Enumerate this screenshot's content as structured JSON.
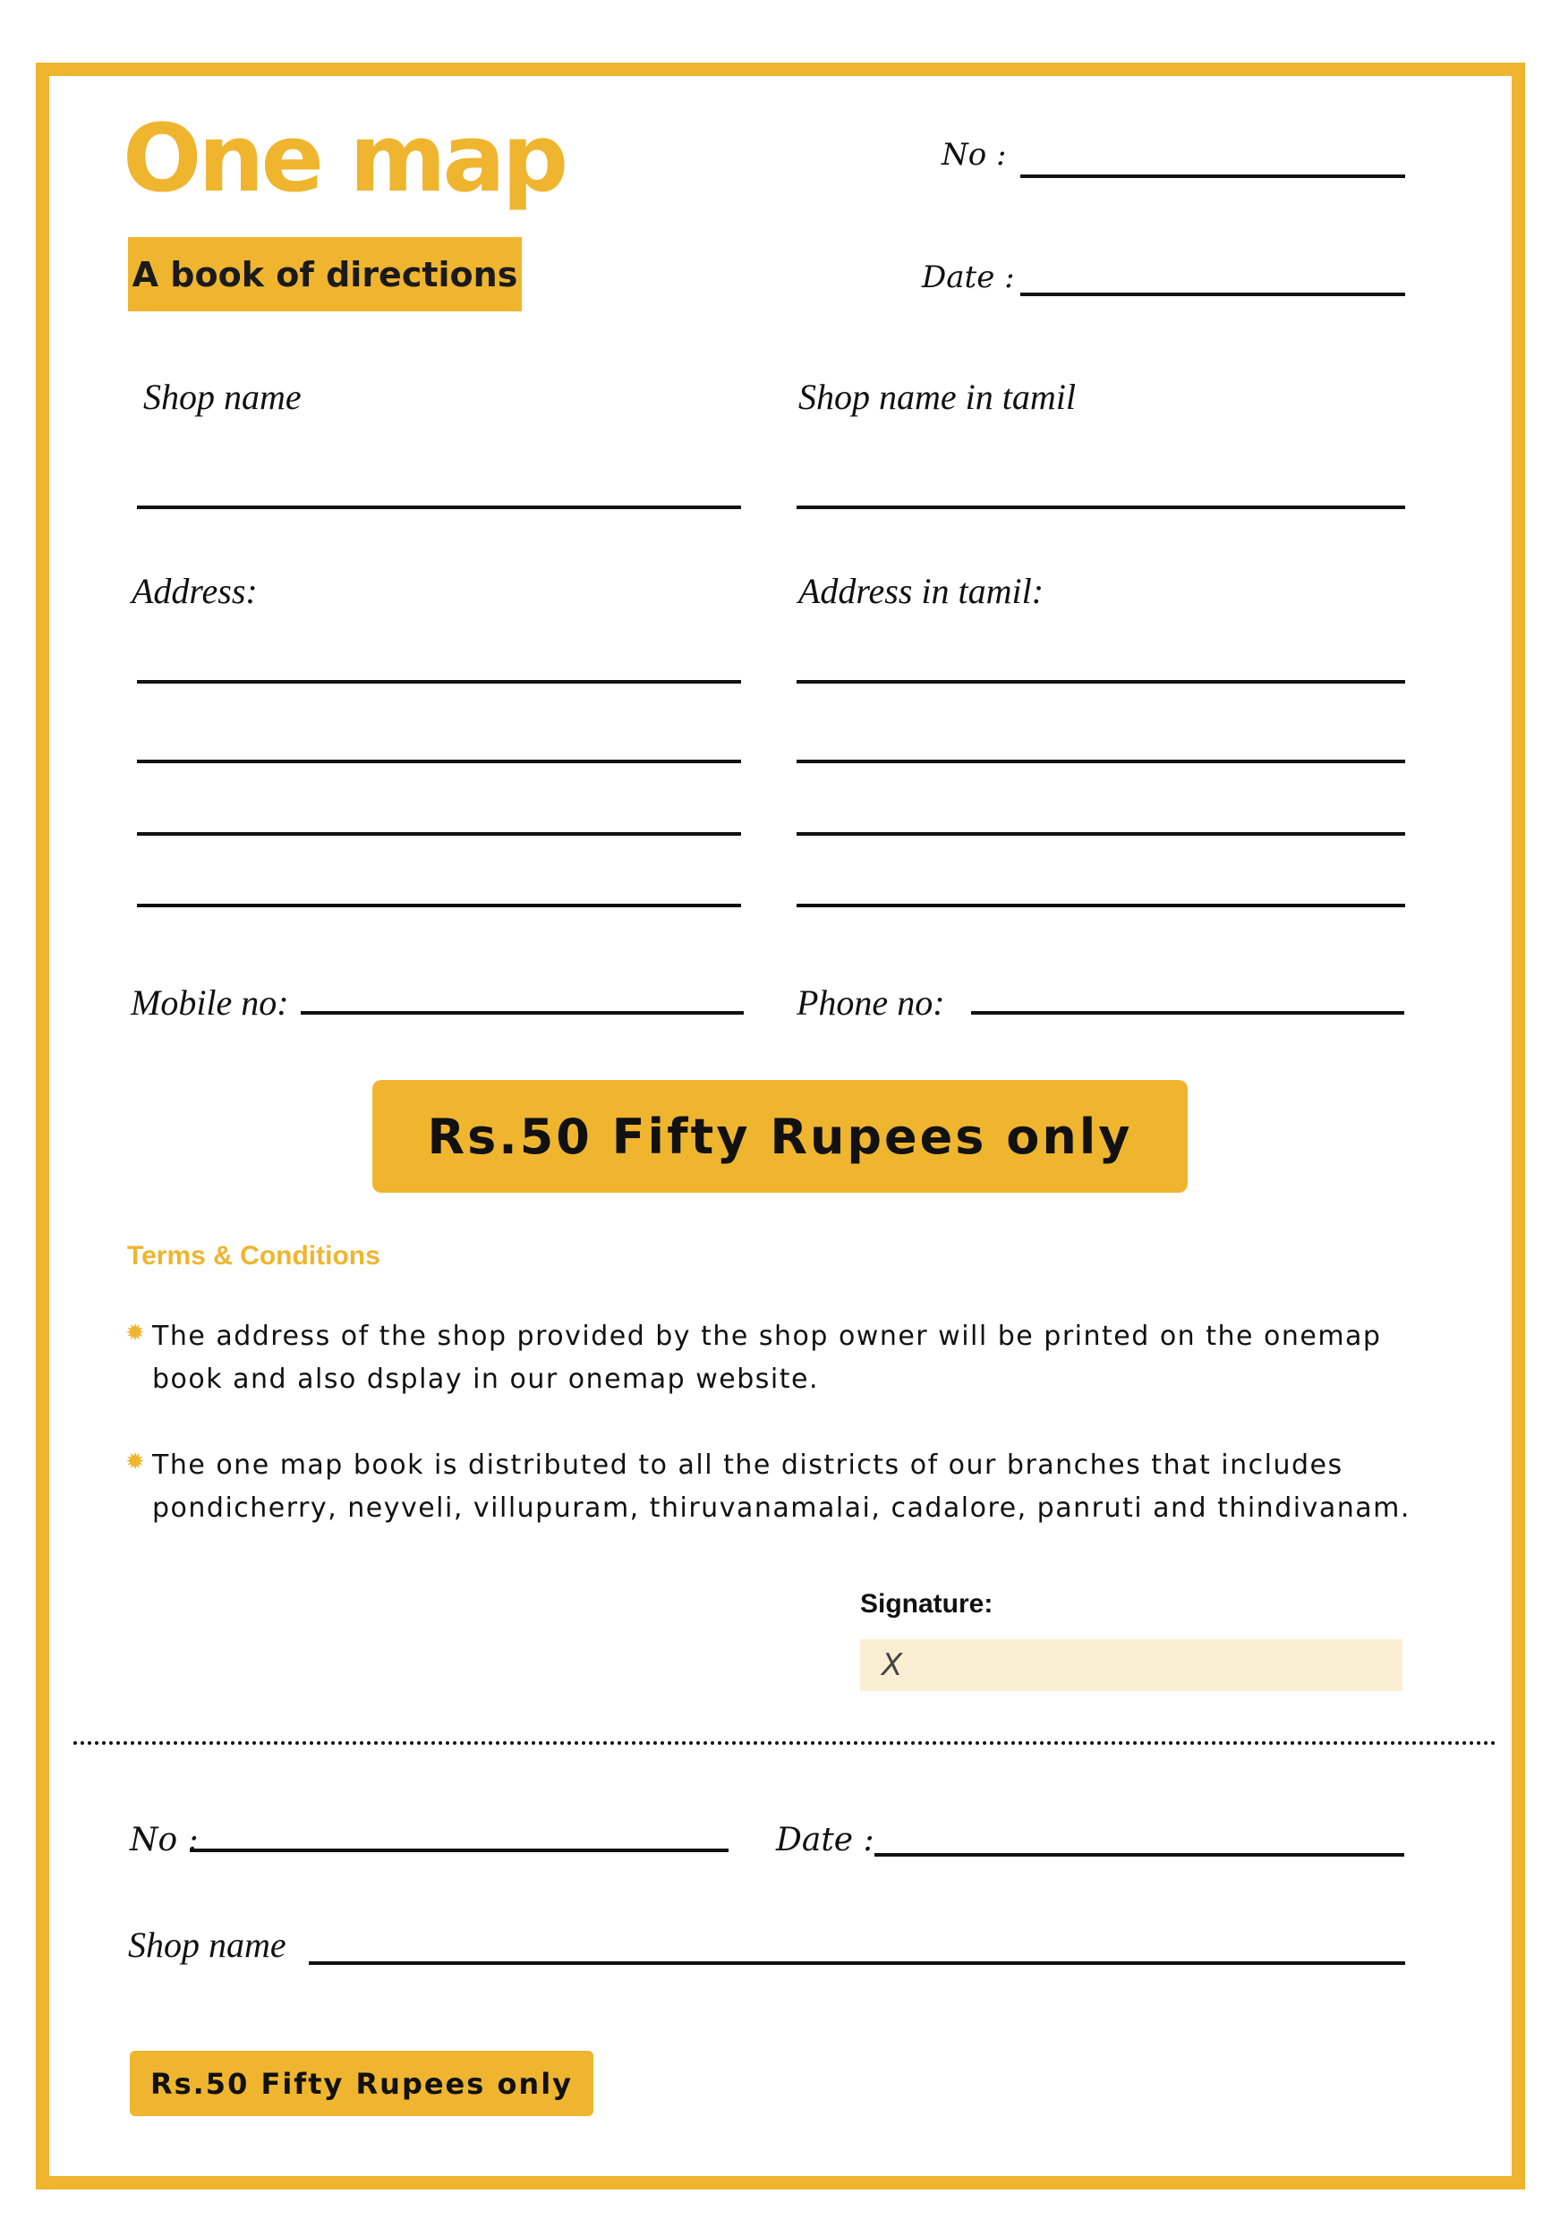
{
  "brand": {
    "title": "One map",
    "tagline": "A book of directions"
  },
  "header": {
    "no_label": "No :",
    "date_label": "Date :"
  },
  "form": {
    "shop_name_label": "Shop  name",
    "shop_name_tamil_label": "Shop  name  in  tamil",
    "address_label": "Address:",
    "address_tamil_label": "Address  in  tamil:",
    "mobile_label": "Mobile  no:",
    "phone_label": "Phone  no:"
  },
  "price": {
    "label": "Rs.50   Fifty Rupees only"
  },
  "terms": {
    "heading": "Terms & Conditions",
    "items": [
      "The address of the shop provided by the shop owner will be printed on the onemap book and also dsplay in our onemap website.",
      "The one map book is distributed to all the districts of our branches that includes pondicherry, neyveli, villupuram, thiruvanamalai, cadalore, panruti and thindivanam."
    ]
  },
  "signature": {
    "label": "Signature:",
    "placeholder": "X"
  },
  "stub": {
    "no_label": "No :",
    "date_label": "Date :",
    "shop_name_label": "Shop  name",
    "price_label": "Rs.50   Fifty Rupees only"
  },
  "colors": {
    "accent": "#efb52f",
    "signature_bg": "#fbefd3",
    "ink": "#111111"
  },
  "icons": {
    "bullet": "sun-burst-icon"
  }
}
